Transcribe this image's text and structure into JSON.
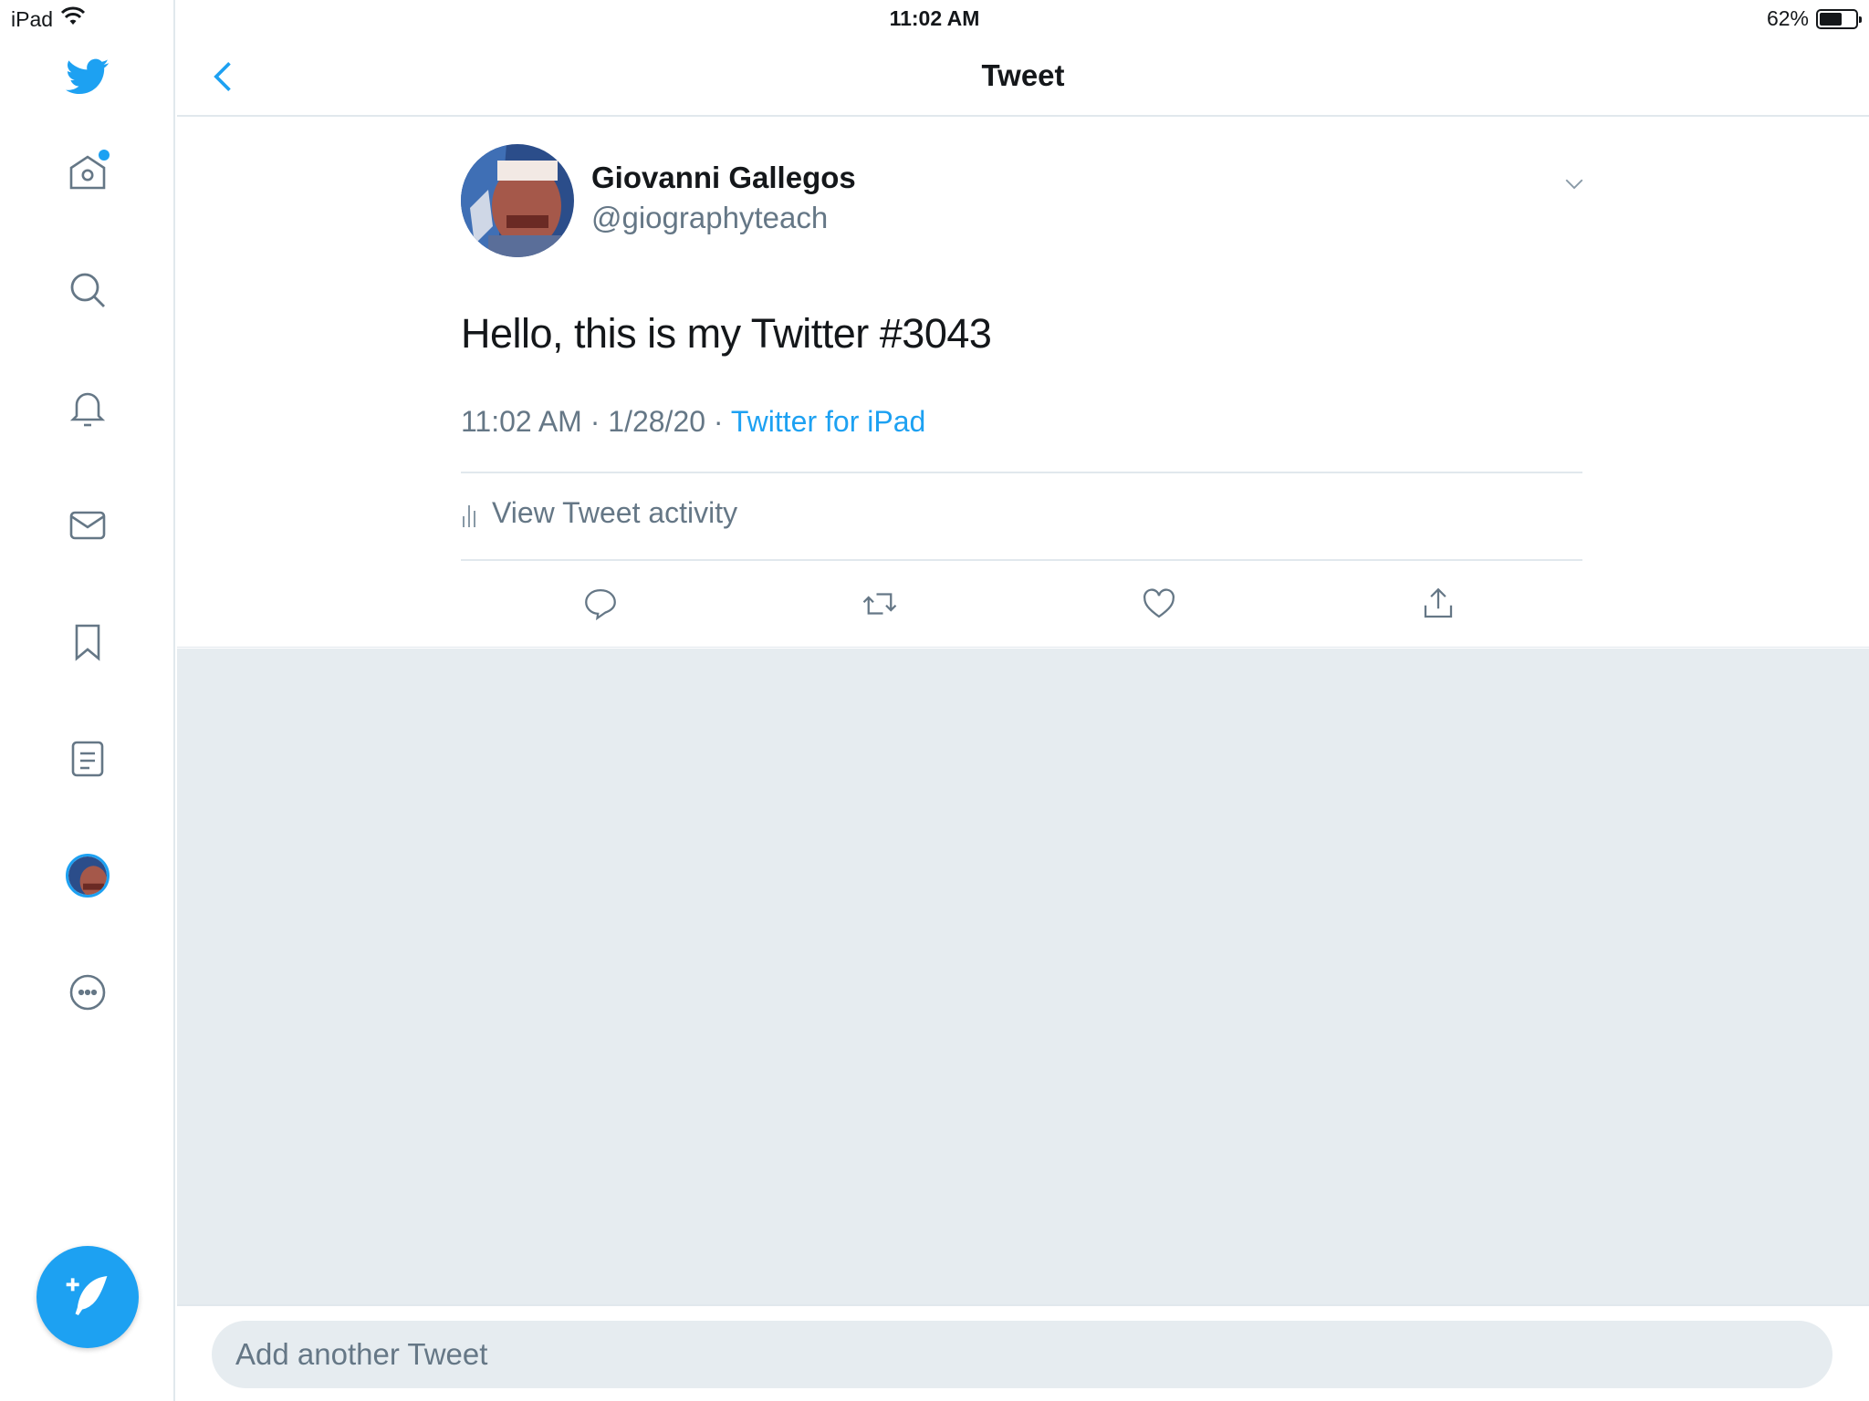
{
  "status_bar": {
    "device": "iPad",
    "time": "11:02 AM",
    "battery": "62%",
    "battery_level": 0.62
  },
  "sidebar": {
    "items": [
      {
        "name": "twitter-logo-icon"
      },
      {
        "name": "home-icon",
        "has_notification_dot": true
      },
      {
        "name": "search-icon"
      },
      {
        "name": "notifications-bell-icon"
      },
      {
        "name": "messages-envelope-icon"
      },
      {
        "name": "bookmarks-icon"
      },
      {
        "name": "lists-icon"
      },
      {
        "name": "profile-avatar"
      },
      {
        "name": "more-icon"
      }
    ],
    "compose_icon": "compose-tweet-icon"
  },
  "header": {
    "title": "Tweet",
    "back_icon": "chevron-left-icon"
  },
  "tweet": {
    "author_name": "Giovanni Gallegos",
    "author_handle": "@giographyteach",
    "text": "Hello, this is my Twitter #3043",
    "timestamp": "11:02 AM · 1/28/20 · ",
    "source": "Twitter for iPad",
    "activity_label": "View Tweet activity",
    "actions": [
      "reply-icon",
      "retweet-icon",
      "like-icon",
      "share-icon"
    ]
  },
  "reply": {
    "placeholder": "Add another Tweet"
  },
  "colors": {
    "accent": "#1da1f2",
    "text_primary": "#14171a",
    "text_secondary": "#657786",
    "background_grey": "#e6ecf0",
    "divider": "#e1e8ed"
  }
}
